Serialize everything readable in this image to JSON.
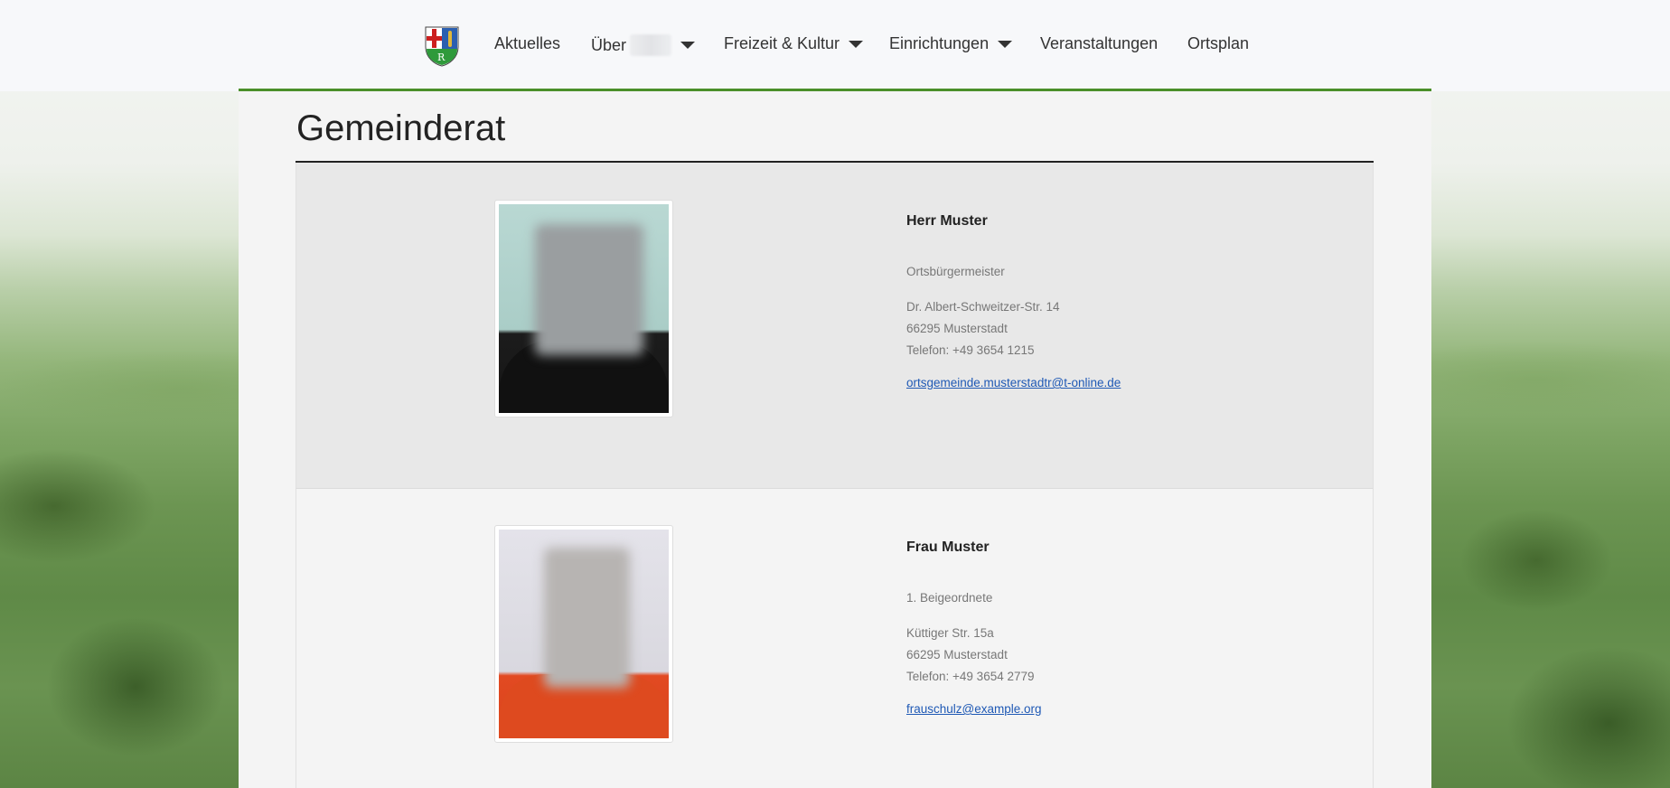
{
  "nav": {
    "items": [
      {
        "label": "Aktuelles",
        "has_dropdown": false
      },
      {
        "label": "Über",
        "has_dropdown": true
      },
      {
        "label": "Freizeit & Kultur",
        "has_dropdown": true
      },
      {
        "label": "Einrichtungen",
        "has_dropdown": true
      },
      {
        "label": "Veranstaltungen",
        "has_dropdown": false
      },
      {
        "label": "Ortsplan",
        "has_dropdown": false
      }
    ],
    "accent_color": "#4a8f2a"
  },
  "page": {
    "title": "Gemeinderat"
  },
  "members": [
    {
      "name": "Herr Muster",
      "role": "Ortsbürgermeister",
      "street": "Dr. Albert-Schweitzer-Str. 14",
      "city": "66295 Musterstadt",
      "phone": "Telefon: +49 3654 1215",
      "email": "ortsgemeinde.musterstadtr@t-online.de"
    },
    {
      "name": "Frau Muster",
      "role": "1. Beigeordnete",
      "street": "Küttiger Str. 15a",
      "city": "66295 Musterstadt",
      "phone": "Telefon: +49 3654 2779",
      "email": "frauschulz@example.org"
    }
  ],
  "colors": {
    "link": "#1f59b5",
    "title_rule": "#222222"
  }
}
